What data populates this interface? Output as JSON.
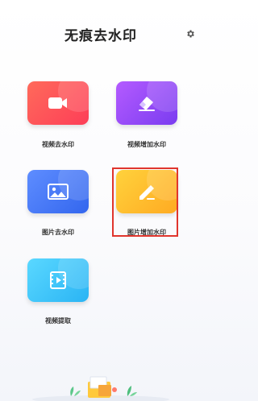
{
  "app": {
    "title": "无痕去水印"
  },
  "header": {
    "settings_icon": "gear-icon"
  },
  "features": [
    {
      "label": "视频去水印",
      "icon": "video-camera-icon",
      "color": "#fd4e57"
    },
    {
      "label": "视频增加水印",
      "icon": "eraser-icon",
      "color": "#9a4cf6"
    },
    {
      "label": "图片去水印",
      "icon": "image-icon",
      "color": "#4677f5"
    },
    {
      "label": "图片增加水印",
      "icon": "pencil-icon",
      "color": "#ffbb2a"
    },
    {
      "label": "视频提取",
      "icon": "film-icon",
      "color": "#37c3f8"
    }
  ],
  "highlight_color": "#e0352d"
}
